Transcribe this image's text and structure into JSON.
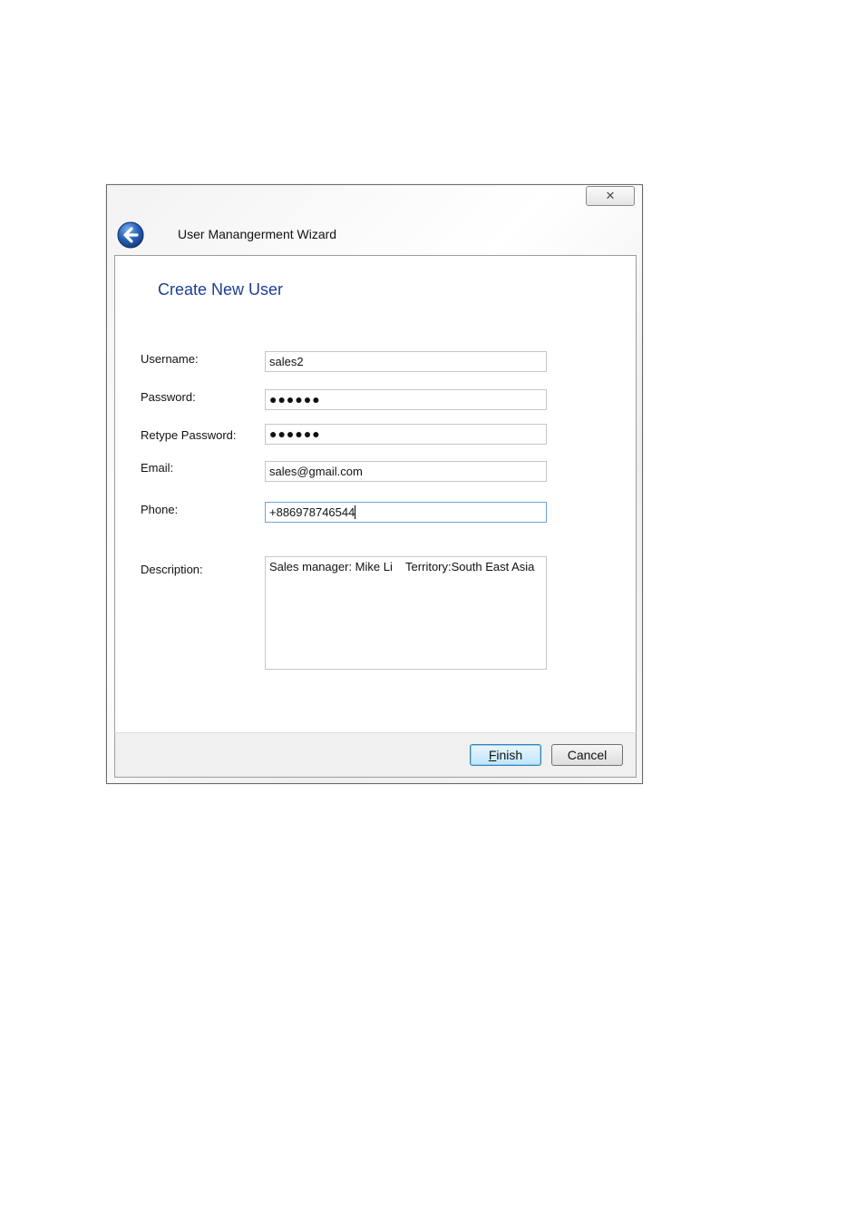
{
  "window": {
    "title": "User Manangerment Wizard",
    "close_glyph": "✕"
  },
  "page": {
    "heading": "Create New User"
  },
  "form": {
    "username": {
      "label": "Username:",
      "value": "sales2"
    },
    "password": {
      "label": "Password:",
      "value": "●●●●●●"
    },
    "retype_password": {
      "label": "Retype Password:",
      "value": "●●●●●●"
    },
    "email": {
      "label": "Email:",
      "value": "sales@gmail.com"
    },
    "phone": {
      "label": "Phone:",
      "value": "+886978746544"
    },
    "description": {
      "label": "Description:",
      "value": "Sales manager: Mike Li    Territory:South East Asia"
    }
  },
  "footer": {
    "finish_mnemonic": "F",
    "finish_rest": "inish",
    "cancel_label": "Cancel"
  },
  "icons": {
    "back": "back-arrow-icon",
    "close": "close-icon"
  },
  "colors": {
    "heading": "#1c3f94",
    "back_icon": "#2b63b8",
    "default_button": "#bee6fd"
  }
}
